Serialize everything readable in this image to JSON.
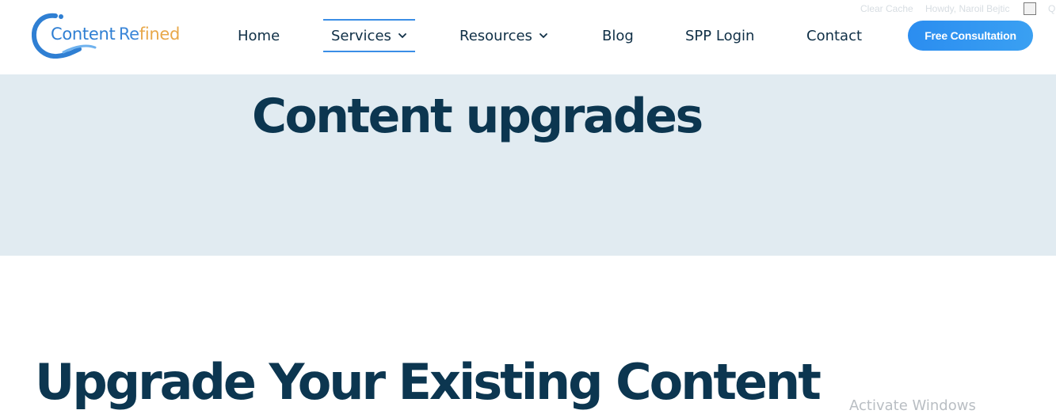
{
  "header": {
    "logo": {
      "word1": "Content",
      "word2": "Re",
      "word3": "fined",
      "colors": {
        "primary": "#2f7fd3",
        "accent": "#e8a84a"
      }
    },
    "nav": [
      {
        "label": "Home"
      },
      {
        "label": "Services",
        "has_dropdown": true,
        "active": true
      },
      {
        "label": "Resources",
        "has_dropdown": true
      },
      {
        "label": "Blog"
      },
      {
        "label": "SPP Login"
      },
      {
        "label": "Contact"
      }
    ],
    "cta_label": "Free Consultation",
    "admin_bar": {
      "clear_cache": "Clear Cache",
      "howdy": "Howdy, Naroil Bejtic"
    }
  },
  "hero": {
    "title": "Content upgrades",
    "background": "#e1ebf1"
  },
  "main": {
    "heading": "Upgrade Your Existing Content"
  },
  "os_watermark": "Activate Windows",
  "colors": {
    "text_dark": "#0c3650",
    "nav_text": "#0f2f46",
    "button": "#2b8df0",
    "active_underline": "#3a8ee6"
  }
}
